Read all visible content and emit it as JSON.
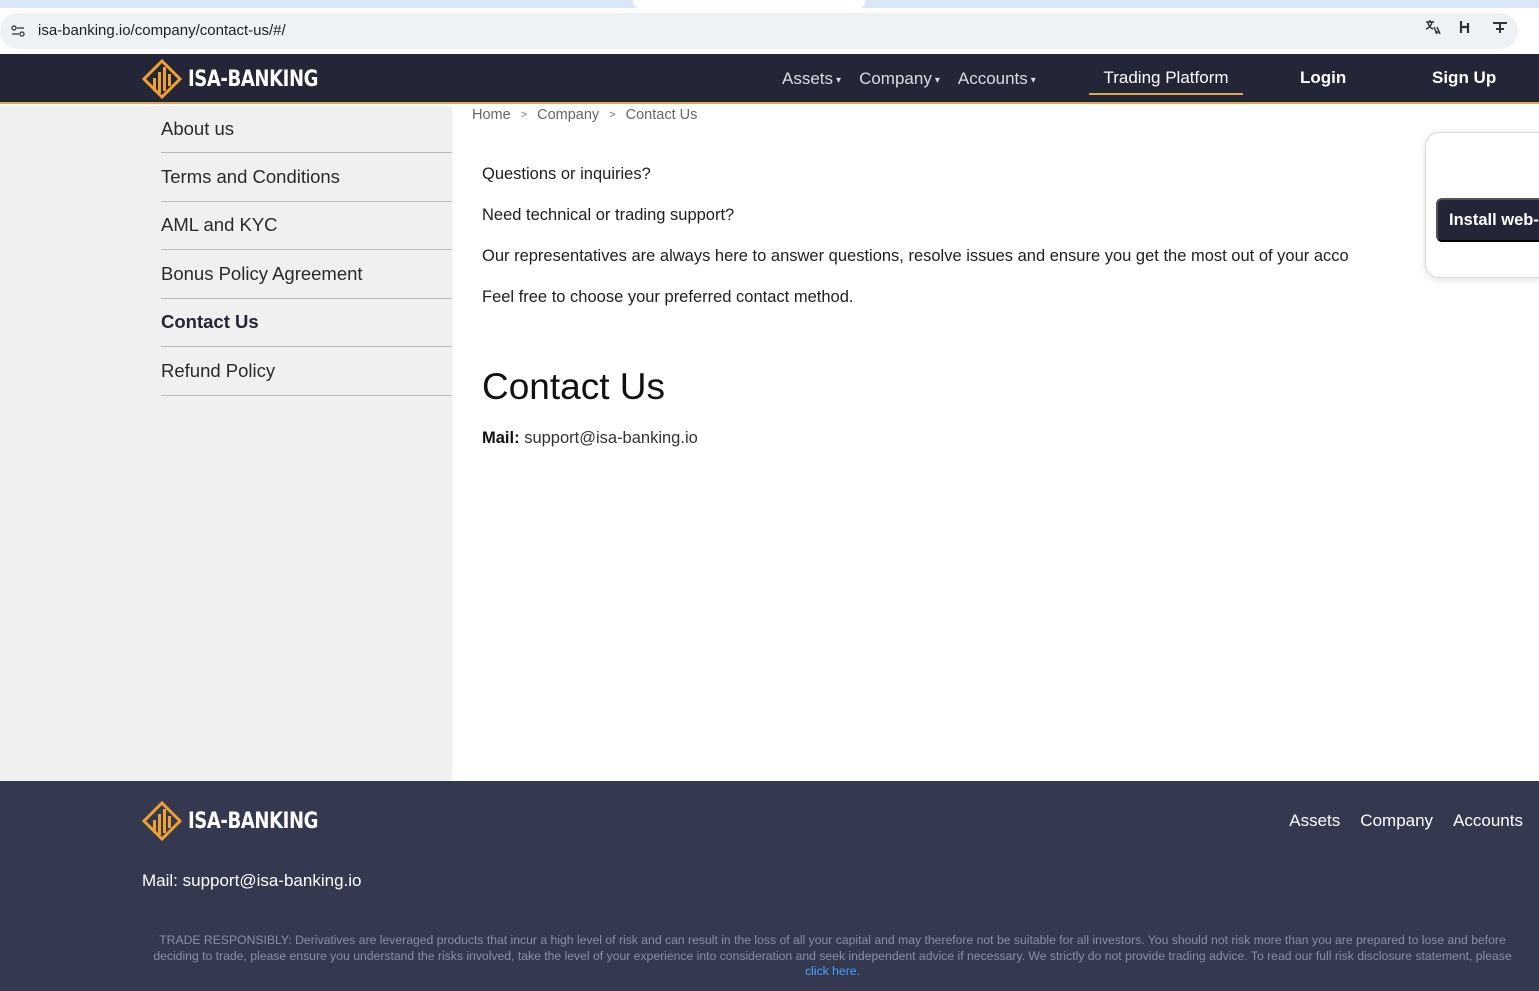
{
  "browser": {
    "url": "isa-banking.io/company/contact-us/#/"
  },
  "brand": {
    "name": "ISA-BANKING",
    "accent": "#f0a030",
    "header_bg": "#222637",
    "footer_bg": "#343950"
  },
  "header": {
    "nav": [
      {
        "label": "Assets",
        "has_dropdown": true
      },
      {
        "label": "Company",
        "has_dropdown": true
      },
      {
        "label": "Accounts",
        "has_dropdown": true
      }
    ],
    "trading_platform": "Trading Platform",
    "login": "Login",
    "signup": "Sign Up"
  },
  "sidebar": {
    "items": [
      {
        "label": "About us"
      },
      {
        "label": "Terms and Conditions"
      },
      {
        "label": "AML and KYC"
      },
      {
        "label": "Bonus Policy Agreement"
      },
      {
        "label": "Contact Us",
        "active": true
      },
      {
        "label": "Refund Policy"
      }
    ]
  },
  "breadcrumb": [
    "Home",
    "Company",
    "Contact Us"
  ],
  "main": {
    "paragraphs": [
      "Questions or inquiries?",
      "Need technical or trading support?",
      "Our representatives are always here to answer questions, resolve issues and ensure you get the most out of your acco",
      "Feel free to choose your preferred contact method."
    ],
    "title": "Contact Us",
    "mail_label": "Mail:",
    "mail_value": "support@isa-banking.io"
  },
  "install_popup": {
    "button": "Install web-"
  },
  "footer": {
    "nav": [
      "Assets",
      "Company",
      "Accounts"
    ],
    "mail": "Mail: support@isa-banking.io",
    "disclaimer": "TRADE RESPONSIBLY: Derivatives are leveraged products that incur a high level of risk and can result in the loss of all your capital and may therefore not be suitable for all investors. You should not risk more than you are prepared to lose and before deciding to trade, please ensure you understand the risks involved, take the level of your experience into consideration and seek independent advice if necessary. We strictly do not provide trading advice. To read our full risk disclosure statement, please ",
    "disclaimer_link": "click here."
  }
}
